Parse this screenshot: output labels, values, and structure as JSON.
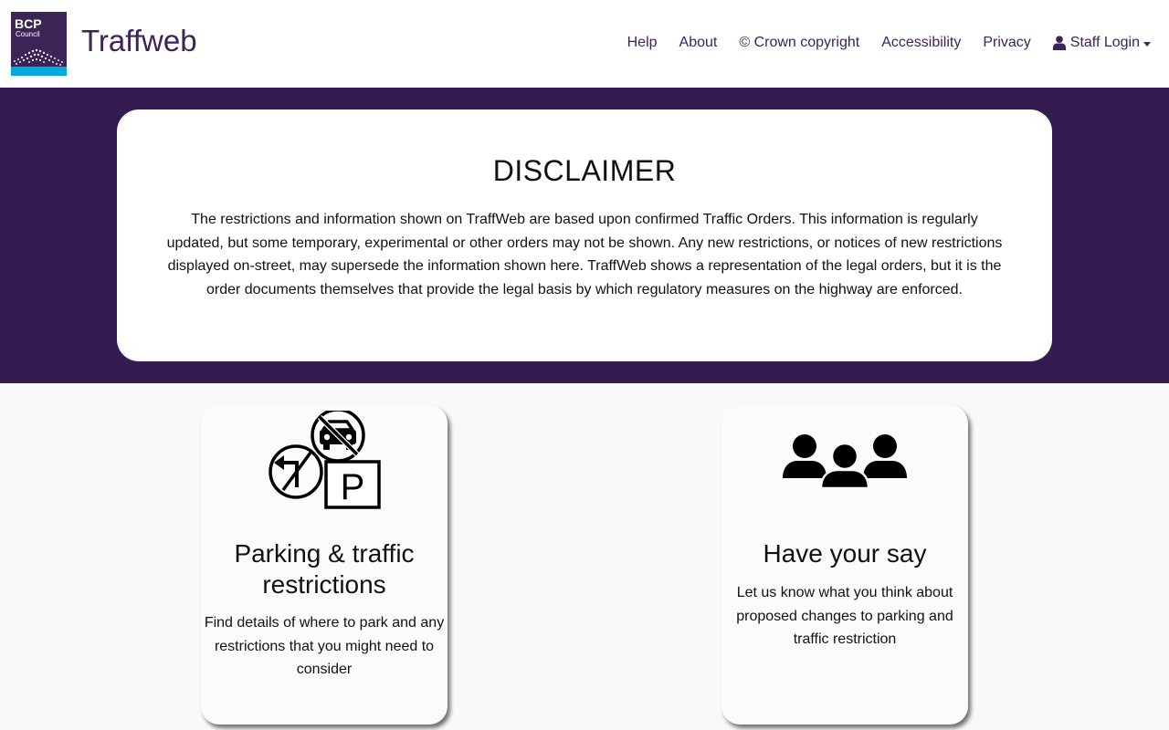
{
  "header": {
    "logo": {
      "line1": "BCP",
      "line2": "Council",
      "colors": {
        "bg": "#3c2556",
        "band": "#00a9e0"
      }
    },
    "brand": "Traffweb",
    "nav": [
      {
        "label": "Help"
      },
      {
        "label": "About"
      },
      {
        "label": "© Crown copyright"
      },
      {
        "label": "Accessibility"
      },
      {
        "label": "Privacy"
      },
      {
        "label": "Staff Login",
        "icon": "user-icon",
        "dropdown": true
      }
    ]
  },
  "disclaimer": {
    "title": "DISCLAIMER",
    "text": "The restrictions and information shown on TraffWeb are based upon confirmed Traffic Orders. This information is regularly updated, but some temporary, experimental or other orders may not be shown. Any new restrictions, or notices of new restrictions displayed on-street, may supersede the information shown here. TraffWeb shows a representation of the legal orders, but it is the order documents themselves that provide the legal basis by which regulatory measures on the highway are enforced."
  },
  "cards": [
    {
      "icon": "parking-traffic-signs-icon",
      "title": "Parking & traffic restrictions",
      "text": "Find details of where to park and any restrictions that you might need to consider",
      "parking_letter": "P"
    },
    {
      "icon": "people-group-icon",
      "title": "Have your say",
      "text": "Let us know what you think about proposed changes to parking and traffic restriction"
    }
  ],
  "colors": {
    "accent": "#3c2556",
    "hero_bg": "#351c50",
    "page_bg": "#f8f9fb"
  }
}
